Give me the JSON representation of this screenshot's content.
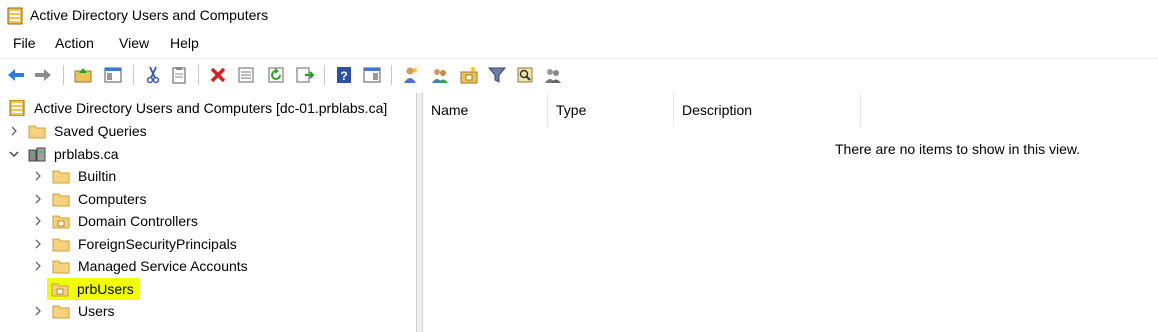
{
  "window": {
    "title": "Active Directory Users and Computers"
  },
  "menu": {
    "items": [
      "File",
      "Action",
      "View",
      "Help"
    ]
  },
  "toolbar": {
    "buttons": [
      "back-arrow-icon",
      "forward-arrow-icon",
      "up-folder-icon",
      "show-hide-tree-icon",
      "cut-icon",
      "copy-icon",
      "delete-icon",
      "properties-icon",
      "refresh-icon",
      "export-list-icon",
      "help-icon",
      "action-pane-icon",
      "new-user-icon",
      "new-group-icon",
      "new-ou-icon",
      "filter-icon",
      "find-icon",
      "add-to-group-icon"
    ]
  },
  "tree": {
    "root": "Active Directory Users and Computers [dc-01.prblabs.ca]",
    "saved_queries": "Saved Queries",
    "domain": "prblabs.ca",
    "children": [
      "Builtin",
      "Computers",
      "Domain Controllers",
      "ForeignSecurityPrincipals",
      "Managed Service Accounts",
      "prbUsers",
      "Users"
    ],
    "highlight_color": "#f2ff00"
  },
  "list": {
    "columns": [
      "Name",
      "Type",
      "Description"
    ],
    "empty_message": "There are no items to show in this view."
  }
}
